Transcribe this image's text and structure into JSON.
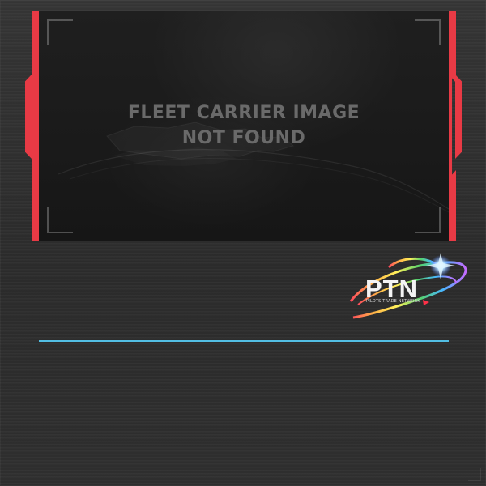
{
  "image_placeholder": {
    "line1": "FLEET CARRIER IMAGE",
    "line2": "NOT FOUND"
  },
  "logo": {
    "title": "PTN",
    "subtitle": "PILOTS TRADE NETWORK",
    "icon": "ptn-rainbow-orbit-logo-icon"
  },
  "colors": {
    "frame_red": "#e83a45",
    "divider_blue": "#52bde2",
    "background": "#2e2e2e",
    "placeholder_text": "#6a6a6a"
  }
}
